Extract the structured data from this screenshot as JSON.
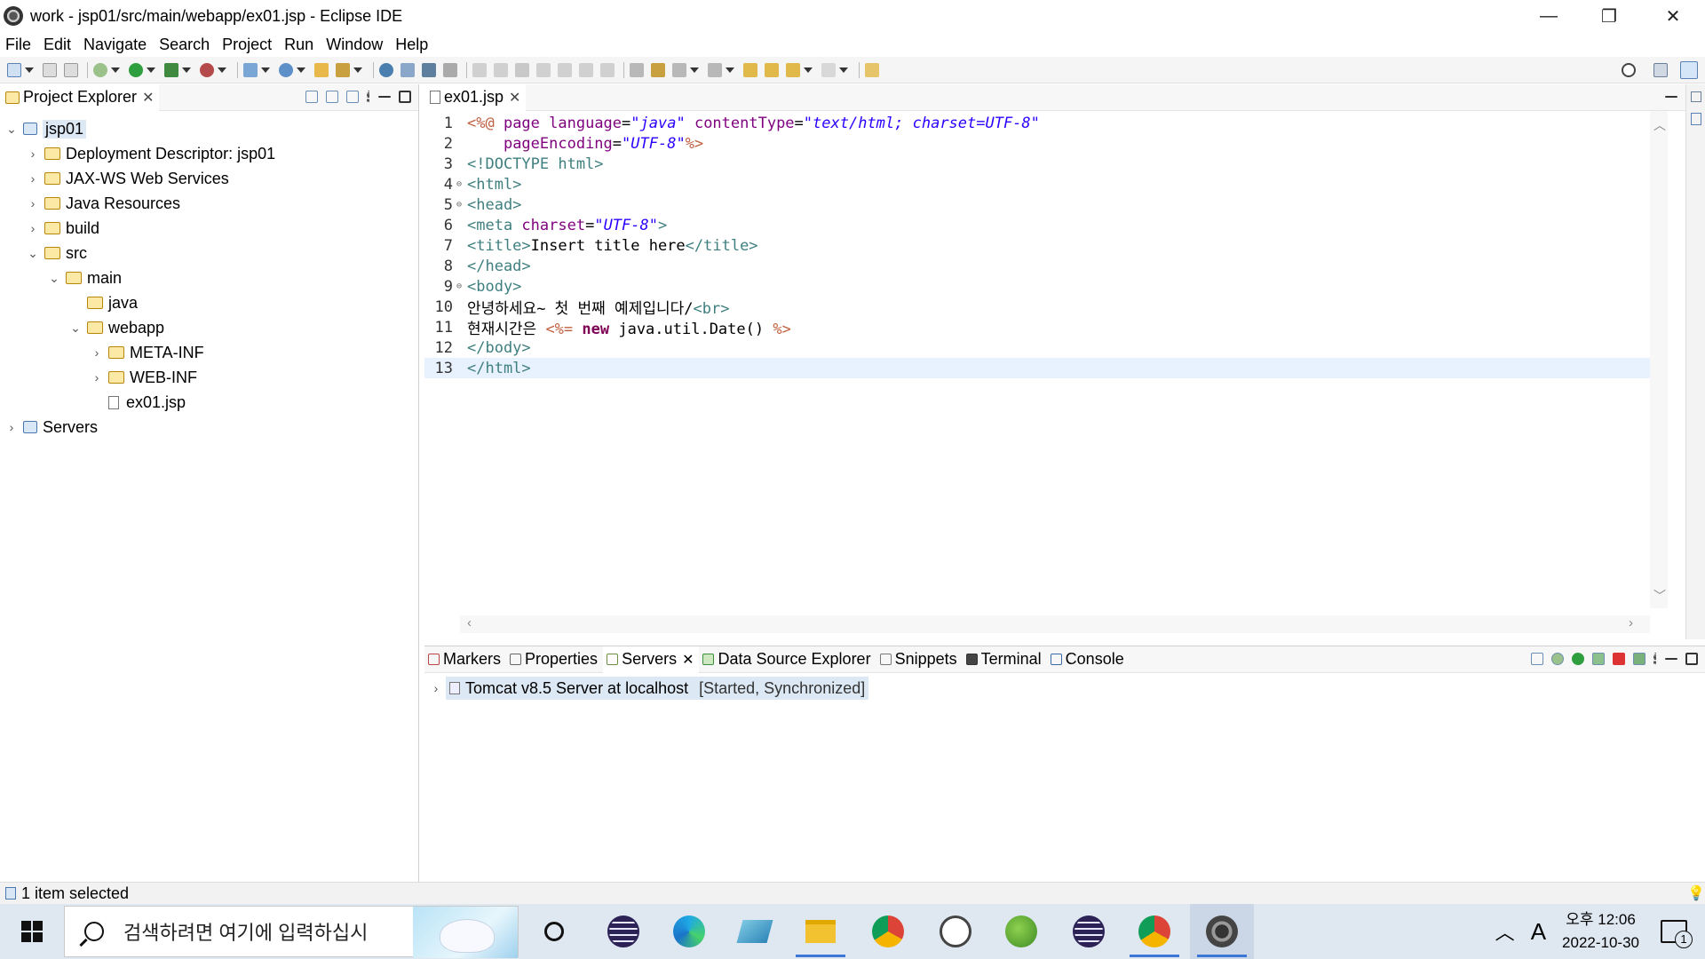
{
  "window": {
    "title": "work - jsp01/src/main/webapp/ex01.jsp - Eclipse IDE",
    "minimize": "—",
    "restore": "❐",
    "close": "✕"
  },
  "menu": [
    "File",
    "Edit",
    "Navigate",
    "Search",
    "Project",
    "Run",
    "Window",
    "Help"
  ],
  "project_explorer": {
    "tab_label": "Project Explorer",
    "tree": [
      {
        "label": "jsp01",
        "level": 0,
        "expanded": true,
        "selected": true
      },
      {
        "label": "Deployment Descriptor: jsp01",
        "level": 1,
        "expanded": false
      },
      {
        "label": "JAX-WS Web Services",
        "level": 1,
        "expanded": false
      },
      {
        "label": "Java Resources",
        "level": 1,
        "expanded": false
      },
      {
        "label": "build",
        "level": 1,
        "expanded": false
      },
      {
        "label": "src",
        "level": 1,
        "expanded": true
      },
      {
        "label": "main",
        "level": 2,
        "expanded": true
      },
      {
        "label": "java",
        "level": 3
      },
      {
        "label": "webapp",
        "level": 3,
        "expanded": true
      },
      {
        "label": "META-INF",
        "level": 4,
        "expanded": false
      },
      {
        "label": "WEB-INF",
        "level": 4,
        "expanded": false
      },
      {
        "label": "ex01.jsp",
        "level": 4
      },
      {
        "label": "Servers",
        "level": 0,
        "expanded": false
      }
    ]
  },
  "editor": {
    "tab_label": "ex01.jsp",
    "current_line": 13,
    "lines": [
      {
        "n": "1",
        "tokens": [
          [
            "jsp",
            "<%@ "
          ],
          [
            "attr",
            "page "
          ],
          [
            "attr",
            "language"
          ],
          [
            "txt",
            "="
          ],
          [
            "val",
            "\"java\""
          ],
          [
            "txt",
            " "
          ],
          [
            "attr",
            "contentType"
          ],
          [
            "txt",
            "="
          ],
          [
            "val",
            "\"text/html; charset=UTF-8\""
          ]
        ]
      },
      {
        "n": "2",
        "tokens": [
          [
            "txt",
            "    "
          ],
          [
            "attr",
            "pageEncoding"
          ],
          [
            "txt",
            "="
          ],
          [
            "val",
            "\"UTF-8\""
          ],
          [
            "jsp",
            "%>"
          ]
        ]
      },
      {
        "n": "3",
        "tokens": [
          [
            "tag",
            "<!DOCTYPE html>"
          ]
        ]
      },
      {
        "n": "4",
        "fold": true,
        "tokens": [
          [
            "tag",
            "<html>"
          ]
        ]
      },
      {
        "n": "5",
        "fold": true,
        "tokens": [
          [
            "tag",
            "<head>"
          ]
        ]
      },
      {
        "n": "6",
        "tokens": [
          [
            "tag",
            "<meta "
          ],
          [
            "attr",
            "charset"
          ],
          [
            "txt",
            "="
          ],
          [
            "val",
            "\"UTF-8\""
          ],
          [
            "tag",
            ">"
          ]
        ]
      },
      {
        "n": "7",
        "tokens": [
          [
            "tag",
            "<title>"
          ],
          [
            "txt",
            "Insert title here"
          ],
          [
            "tag",
            "</title>"
          ]
        ]
      },
      {
        "n": "8",
        "tokens": [
          [
            "tag",
            "</head>"
          ]
        ]
      },
      {
        "n": "9",
        "fold": true,
        "tokens": [
          [
            "tag",
            "<body>"
          ]
        ]
      },
      {
        "n": "10",
        "tokens": [
          [
            "txt",
            "안녕하세요~ 첫 번째 예제입니다/"
          ],
          [
            "tag",
            "<br>"
          ]
        ]
      },
      {
        "n": "11",
        "tokens": [
          [
            "txt",
            "현재시간은 "
          ],
          [
            "jsp",
            "<%= "
          ],
          [
            "kw",
            "new"
          ],
          [
            "txt",
            " java.util.Date() "
          ],
          [
            "jsp",
            "%>"
          ]
        ]
      },
      {
        "n": "12",
        "tokens": [
          [
            "tag",
            "</body>"
          ]
        ]
      },
      {
        "n": "13",
        "tokens": [
          [
            "tag",
            "</html>"
          ]
        ]
      }
    ]
  },
  "bottom_panel": {
    "tabs": [
      "Markers",
      "Properties",
      "Servers",
      "Data Source Explorer",
      "Snippets",
      "Terminal",
      "Console"
    ],
    "active_tab": "Servers",
    "server_row": {
      "name": "Tomcat v8.5 Server at localhost",
      "state": "[Started, Synchronized]"
    }
  },
  "status": {
    "text": "1 item selected"
  },
  "taskbar": {
    "search_placeholder": "검색하려면 여기에 입력하십시",
    "clock_period": "오후 12:06",
    "clock_date": "2022-10-30",
    "ime": "A",
    "notification_count": "1"
  }
}
